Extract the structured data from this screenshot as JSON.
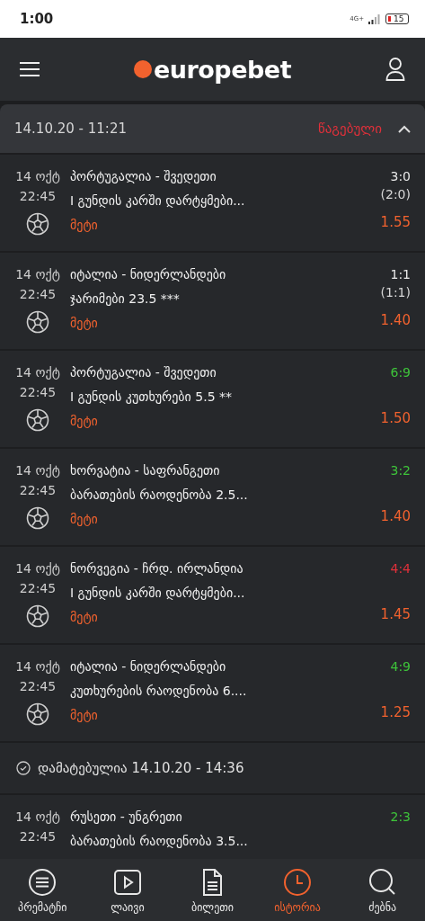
{
  "status_bar": {
    "time": "1:00",
    "network": "4G+",
    "battery": "15"
  },
  "header": {
    "logo": "europebet"
  },
  "bet": {
    "date": "14.10.20 - 11:21",
    "status": "წაგებული",
    "expanded": true,
    "items": [
      {
        "date": "14 ოქტ",
        "time": "22:45",
        "match": "პორტუგალია - შვედეთი",
        "market": "I გუნდის კარში დარტყმები...",
        "pick": "მეტი",
        "score": "3:0",
        "halftime": "(2:0)",
        "color": "#e8e8e8",
        "odd": "1.55"
      },
      {
        "date": "14 ოქტ",
        "time": "22:45",
        "match": "იტალია - ნიდერლანდები",
        "market": "ჯარიმები 23.5 ***",
        "pick": "მეტი",
        "score": "1:1",
        "halftime": "(1:1)",
        "color": "#e8e8e8",
        "odd": "1.40"
      },
      {
        "date": "14 ოქტ",
        "time": "22:45",
        "match": "პორტუგალია - შვედეთი",
        "market": "I გუნდის კუთხურები 5.5 **",
        "pick": "მეტი",
        "score": "6:9",
        "color": "#3ec43a",
        "odd": "1.50"
      },
      {
        "date": "14 ოქტ",
        "time": "22:45",
        "match": "ხორვატია - საფრანგეთი",
        "market": "ბარათების რაოდენობა 2.5...",
        "pick": "მეტი",
        "score": "3:2",
        "color": "#3ec43a",
        "odd": "1.40"
      },
      {
        "date": "14 ოქტ",
        "time": "22:45",
        "match": "ნორვეგია - ჩრდ. ირლანდია",
        "market": "I გუნდის კარში დარტყმები...",
        "pick": "მეტი",
        "score": "4:4",
        "color": "#e0303a",
        "odd": "1.45"
      },
      {
        "date": "14 ოქტ",
        "time": "22:45",
        "match": "იტალია - ნიდერლანდები",
        "market": "კუთხურების რაოდენობა 6....",
        "pick": "მეტი",
        "score": "4:9",
        "color": "#3ec43a",
        "odd": "1.25"
      }
    ],
    "added": "დამატებულია 14.10.20 - 14:36",
    "extra_items": [
      {
        "date": "14 ოქტ",
        "time": "22:45",
        "match": "რუსეთი - უნგრეთი",
        "market": "ბარათების რაოდენობა 3.5...",
        "score": "2:3",
        "color": "#3ec43a"
      }
    ]
  },
  "nav": [
    {
      "kind": "prematch",
      "label": "პრემატჩი",
      "selected": false
    },
    {
      "kind": "live",
      "label": "ლაივი",
      "selected": false
    },
    {
      "kind": "ticket",
      "label": "ბილეთი",
      "selected": false
    },
    {
      "kind": "history",
      "label": "ისტორია",
      "selected": true
    },
    {
      "kind": "search",
      "label": "ძებნა",
      "selected": false
    }
  ]
}
